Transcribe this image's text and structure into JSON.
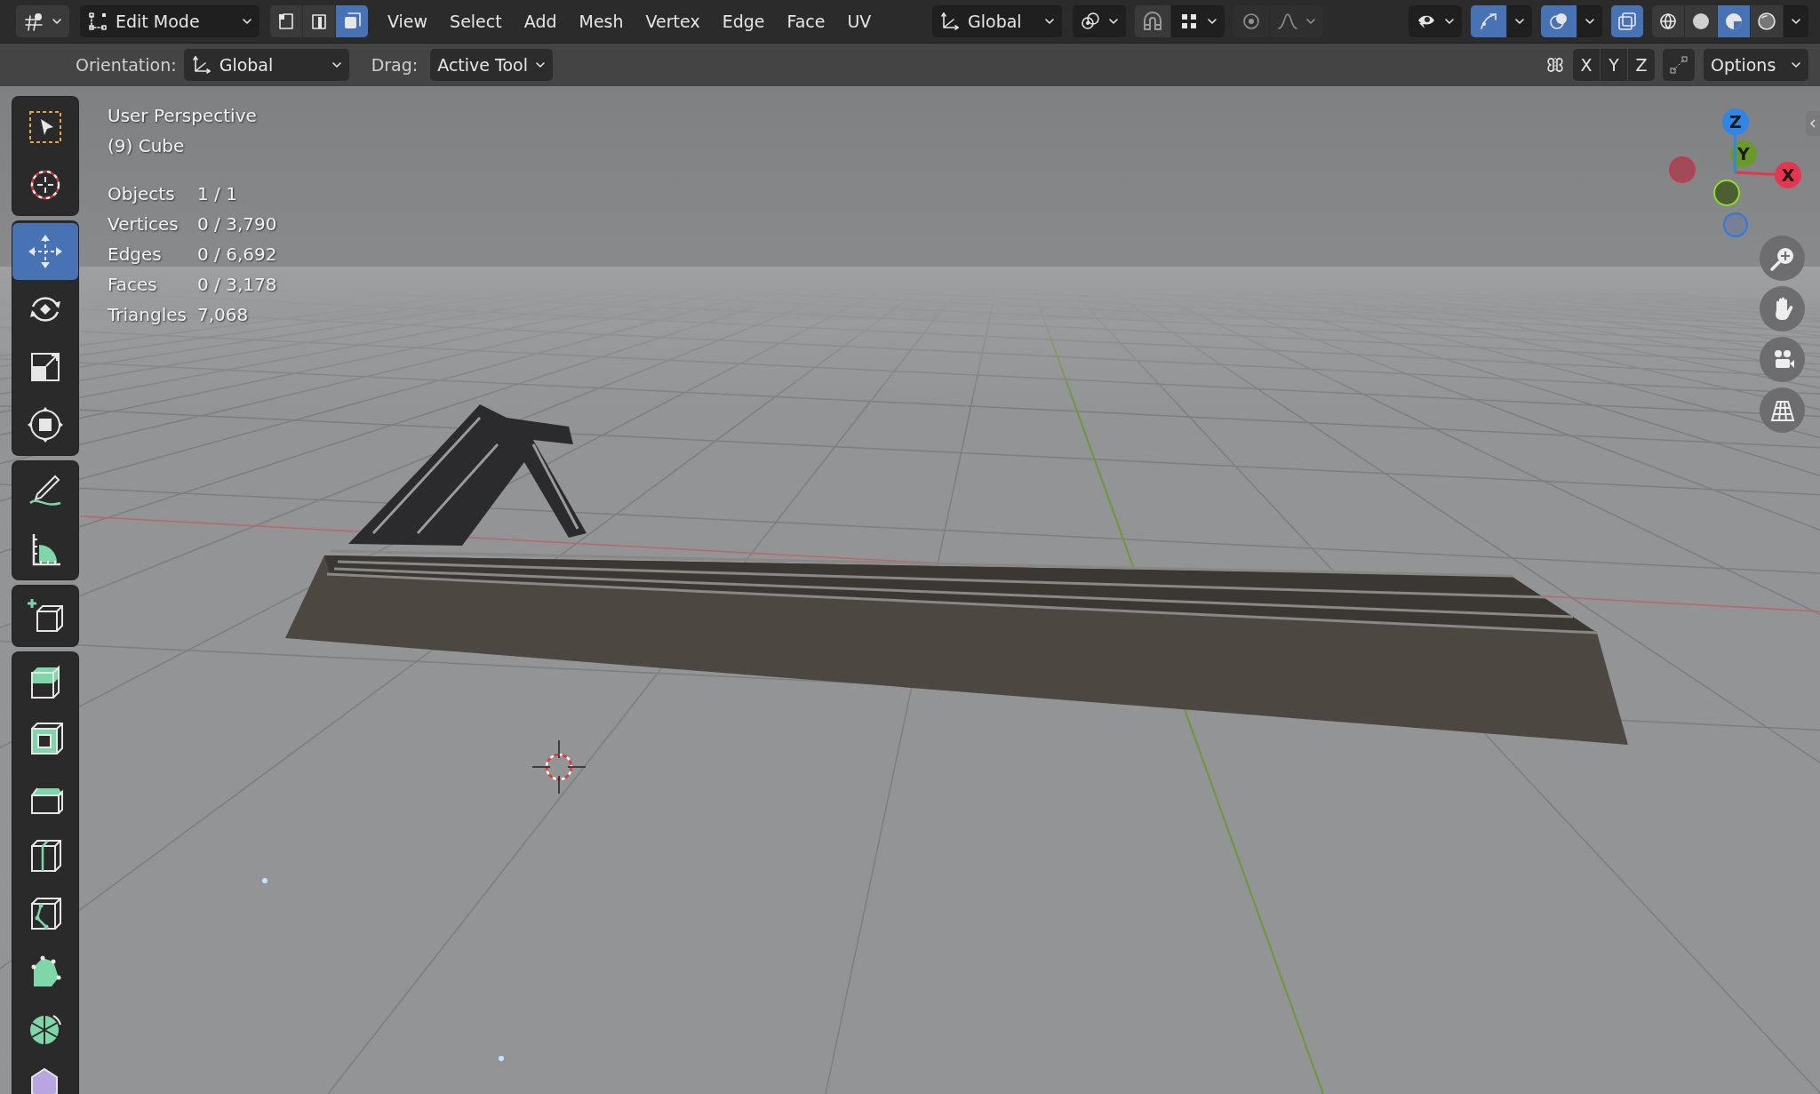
{
  "header": {
    "mode": "Edit Mode",
    "select_modes": [
      {
        "kind": "vertex",
        "selected": false
      },
      {
        "kind": "edge",
        "selected": false
      },
      {
        "kind": "face",
        "selected": true
      }
    ],
    "menus": [
      "View",
      "Select",
      "Add",
      "Mesh",
      "Vertex",
      "Edge",
      "Face",
      "UV"
    ],
    "orientation": "Global",
    "snap": {
      "on": false
    },
    "proportional": {
      "on": false
    },
    "gizmos": {
      "on": true
    },
    "overlays": {
      "on": true
    },
    "xray": {
      "on": true
    },
    "shading": [
      {
        "kind": "wireframe",
        "selected": false
      },
      {
        "kind": "solid",
        "selected": false
      },
      {
        "kind": "material",
        "selected": true
      },
      {
        "kind": "rendered",
        "selected": false
      }
    ]
  },
  "tool_settings": {
    "orientation_label": "Orientation:",
    "orientation": "Global",
    "drag_label": "Drag:",
    "drag": "Active Tool",
    "mirror_axes": [
      {
        "label": "X",
        "selected": false
      },
      {
        "label": "Y",
        "selected": false
      },
      {
        "label": "Z",
        "selected": false
      }
    ],
    "options": "Options"
  },
  "toolbar": {
    "groups": [
      [
        {
          "kind": "select_box",
          "selected": false
        },
        {
          "kind": "cursor",
          "selected": false
        }
      ],
      [
        {
          "kind": "move",
          "selected": true
        },
        {
          "kind": "rotate",
          "selected": false
        },
        {
          "kind": "scale",
          "selected": false
        },
        {
          "kind": "transform",
          "selected": false
        }
      ],
      [
        {
          "kind": "annotate",
          "selected": false
        },
        {
          "kind": "measure",
          "selected": false
        }
      ],
      [
        {
          "kind": "add_cube",
          "selected": false
        }
      ],
      [
        {
          "kind": "extrude",
          "selected": false
        },
        {
          "kind": "inset",
          "selected": false
        },
        {
          "kind": "bevel",
          "selected": false
        },
        {
          "kind": "loop_cut",
          "selected": false
        },
        {
          "kind": "knife",
          "selected": false
        },
        {
          "kind": "poly_build",
          "selected": false
        },
        {
          "kind": "spin",
          "selected": false
        },
        {
          "kind": "smooth",
          "selected": false
        }
      ]
    ]
  },
  "viewport": {
    "title": "User Perspective",
    "object": "(9) Cube",
    "stats": [
      {
        "label": "Objects",
        "value": "1 / 1"
      },
      {
        "label": "Vertices",
        "value": "0 / 3,790"
      },
      {
        "label": "Edges",
        "value": "0 / 6,692"
      },
      {
        "label": "Faces",
        "value": "0 / 3,178"
      },
      {
        "label": "Triangles",
        "value": "7,068"
      }
    ]
  },
  "navigation_gizmo": {
    "axes": [
      {
        "label": "Z"
      },
      {
        "label": "Y"
      },
      {
        "label": "X"
      }
    ]
  }
}
